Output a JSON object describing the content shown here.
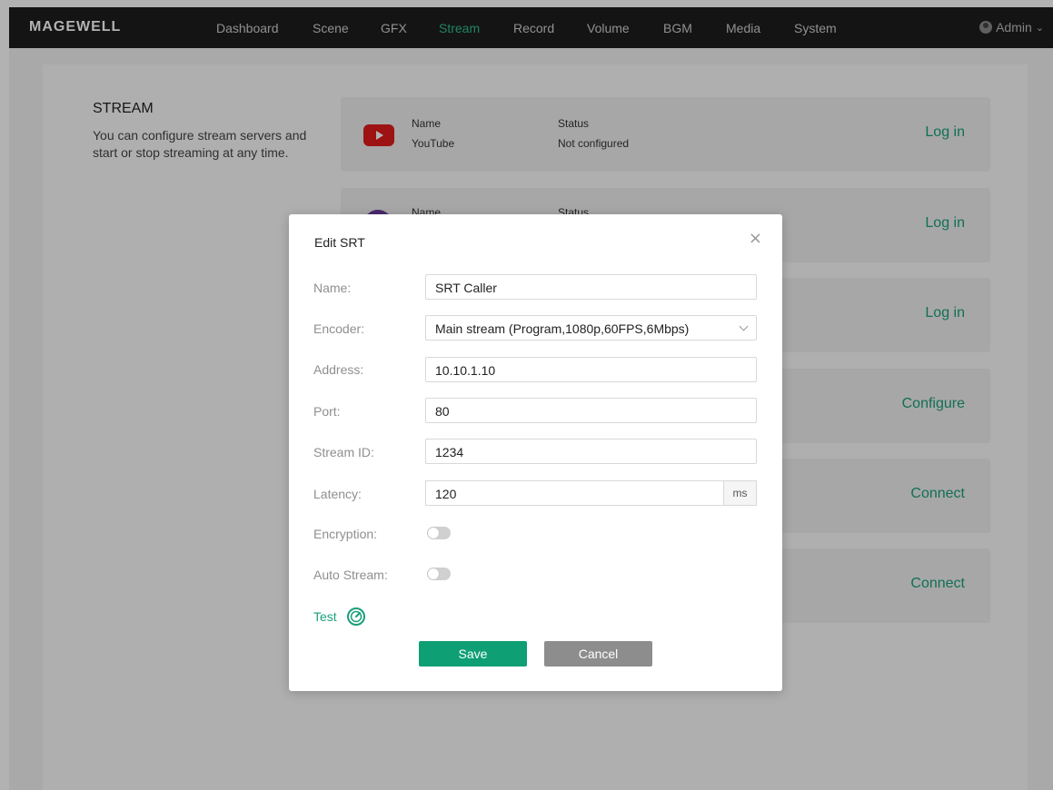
{
  "brand": "MAGEWELL",
  "nav": [
    "Dashboard",
    "Scene",
    "GFX",
    "Stream",
    "Record",
    "Volume",
    "BGM",
    "Media",
    "System"
  ],
  "active_nav": "Stream",
  "user": {
    "name": "Admin"
  },
  "page": {
    "title": "STREAM",
    "description": "You can configure stream servers and start or stop streaming at any time."
  },
  "cards": [
    {
      "name_label": "Name",
      "name": "YouTube",
      "status_label": "Status",
      "status": "Not configured",
      "action": "Log in"
    },
    {
      "name_label": "Name",
      "status_label": "Status",
      "action": "Log in"
    },
    {
      "action": "Log in"
    },
    {
      "action": "Configure"
    },
    {
      "action": "Connect"
    },
    {
      "action": "Connect"
    }
  ],
  "dialog": {
    "title": "Edit SRT",
    "close": "×",
    "labels": {
      "name": "Name:",
      "encoder": "Encoder:",
      "address": "Address:",
      "port": "Port:",
      "stream_id": "Stream ID:",
      "latency": "Latency:",
      "encryption": "Encryption:",
      "auto_stream": "Auto Stream:"
    },
    "values": {
      "name": "SRT Caller",
      "encoder": "Main stream (Program,1080p,60FPS,6Mbps)",
      "address": "10.10.1.10",
      "port": "80",
      "stream_id": "1234",
      "latency": "120",
      "latency_unit": "ms",
      "encryption": false,
      "auto_stream": false
    },
    "test_label": "Test",
    "save_label": "Save",
    "cancel_label": "Cancel"
  },
  "colors": {
    "accent": "#19a07a",
    "save": "#0e9f74",
    "cancel": "#8d8d8d",
    "topbar": "#1d1d1d"
  }
}
